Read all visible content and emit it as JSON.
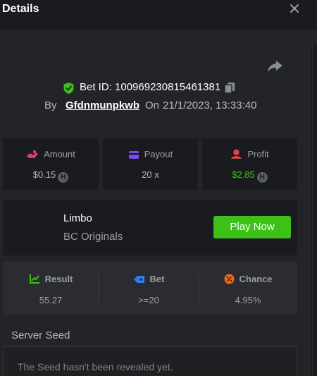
{
  "header": {
    "title": "Details"
  },
  "bet": {
    "id_label": "Bet ID: 100969230815461381",
    "by_label": "By",
    "username": "Gfdnmunpkwb",
    "on_label": "On",
    "date": "21/1/2023, 13:33:40"
  },
  "stats": {
    "amount": {
      "label": "Amount",
      "value": "$0.15",
      "coin": "H"
    },
    "payout": {
      "label": "Payout",
      "value": "20 x"
    },
    "profit": {
      "label": "Profit",
      "value": "$2.85",
      "coin": "H"
    }
  },
  "game": {
    "name": "Limbo",
    "provider": "BC Originals",
    "play_label": "Play Now"
  },
  "result": {
    "result": {
      "label": "Result",
      "value": "55.27"
    },
    "bet": {
      "label": "Bet",
      "value": ">=20"
    },
    "chance": {
      "label": "Chance",
      "value": "4.95%"
    }
  },
  "seed": {
    "label": "Server Seed",
    "message": "The Seed hasn't been revealed yet."
  },
  "colors": {
    "accent_green": "#3bc117",
    "amount_pink": "#e0397a",
    "payout_purple": "#7b4ff0",
    "profit_red": "#e04848",
    "bet_blue": "#2f7df5",
    "chance_orange": "#f06a10"
  },
  "icons": [
    "close-icon",
    "share-icon",
    "shield-check-icon",
    "copy-icon",
    "amount-icon",
    "payout-card-icon",
    "profit-icon",
    "result-chart-icon",
    "bet-tag-icon",
    "chance-percent-icon",
    "coin-icon"
  ]
}
